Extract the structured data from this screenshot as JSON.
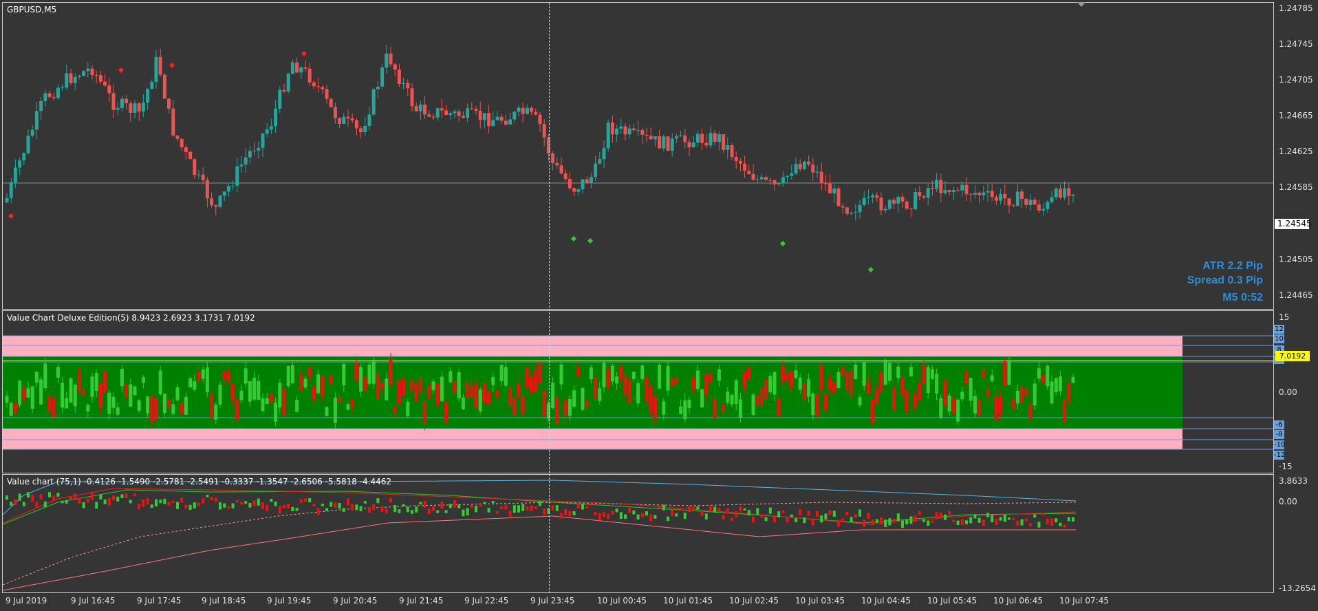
{
  "chart": {
    "symbol_label": "GBPUSD,M5",
    "current_price": "1.24545",
    "price_ticks": [
      "1.24785",
      "1.24745",
      "1.24705",
      "1.24665",
      "1.24625",
      "1.24585",
      "1.24505",
      "1.24465"
    ],
    "info": {
      "atr": "ATR 2.2 Pip",
      "spread": "Spread 0.3 Pip",
      "timer": "M5 0:52"
    },
    "time_labels": [
      "9 Jul 2019",
      "9 Jul 16:45",
      "9 Jul 17:45",
      "9 Jul 18:45",
      "9 Jul 19:45",
      "9 Jul 20:45",
      "9 Jul 21:45",
      "9 Jul 22:45",
      "9 Jul 23:45",
      "10 Jul 00:45",
      "10 Jul 01:45",
      "10 Jul 02:45",
      "10 Jul 03:45",
      "10 Jul 04:45",
      "10 Jul 05:45",
      "10 Jul 06:45",
      "10 Jul 07:45"
    ]
  },
  "indicator1": {
    "title": "Value Chart Deluxe Edition(5) 8.9423 2.6923 3.1731 7.0192",
    "axis_top": "15",
    "axis_mid": "0.00",
    "axis_bottom": "-15",
    "current_value": "7.0192",
    "levels": [
      "12",
      "10",
      "8",
      "6",
      "-6",
      "-8",
      "-10",
      "-12"
    ],
    "colors": {
      "green_zone": "#008000",
      "pink_zone": "#ffb0c0",
      "up": "#33cc33",
      "down": "#ee1111"
    }
  },
  "indicator2": {
    "title": "Value chart (75,1) -0.4126 -1.5490 -2.5781 -2.5491 -0.3337 -1.3547 -2.6506 -5.5818 -4.4462",
    "axis_top": "3.8633",
    "axis_mid": "0.00",
    "axis_bottom": "-13.2654"
  },
  "colors": {
    "background": "#353535",
    "bull": "#26a69a",
    "bear": "#ef5350",
    "text_blue": "#2a8ed8"
  }
}
